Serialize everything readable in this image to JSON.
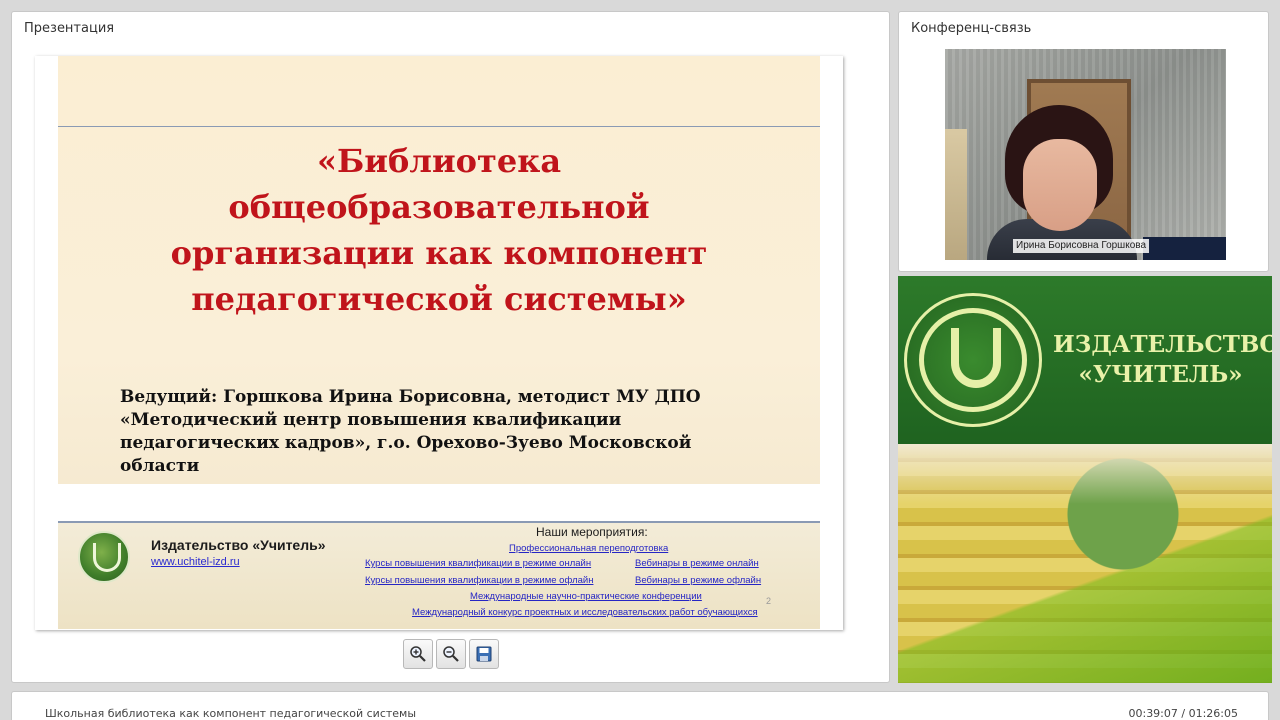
{
  "presentation": {
    "title": "Презентация",
    "slide": {
      "title_lines": [
        "«Библиотека",
        "общеобразовательной",
        "организации как компонент",
        "педагогической системы»"
      ],
      "host_lines": [
        "Ведущий:  Горшкова Ирина Борисовна, методист МУ ДПО",
        "«Методический центр повышения квалификации",
        "педагогических кадров», г.о. Орехово-Зуево Московской",
        "области"
      ],
      "footer": {
        "brand": "Издательство «Учитель»",
        "url": "www.uchitel-izd.ru",
        "events_title": "Наши мероприятия:",
        "links": [
          "Профессиональная переподготовка",
          "Курсы повышения квалификации в режиме онлайн",
          "Вебинары в режиме онлайн",
          "Курсы повышения квалификации в режиме офлайн",
          "Вебинары в режиме офлайн",
          "Международные научно-практические конференции",
          "Международный конкурс проектных и исследовательских работ обучающихся"
        ]
      },
      "page_number": "2"
    },
    "toolbar": {
      "zoom_in": "zoom-in-icon",
      "zoom_out": "zoom-out-icon",
      "save": "save-icon"
    }
  },
  "conference": {
    "title": "Конференц-связь",
    "participant_name": "Ирина Борисовна Горшкова"
  },
  "banner": {
    "lines": [
      "ИЗДАТЕЛЬСТВО",
      "«УЧИТЕЛЬ»"
    ]
  },
  "footer_bar": {
    "title": "Школьная библиотека как компонент педагогической системы",
    "time": "00:39:07 / 01:26:05"
  },
  "colors": {
    "slide_title": "#c0141b",
    "banner_green": "#2d7a2a",
    "banner_text": "#e9f1a9",
    "link": "#2626c4"
  }
}
